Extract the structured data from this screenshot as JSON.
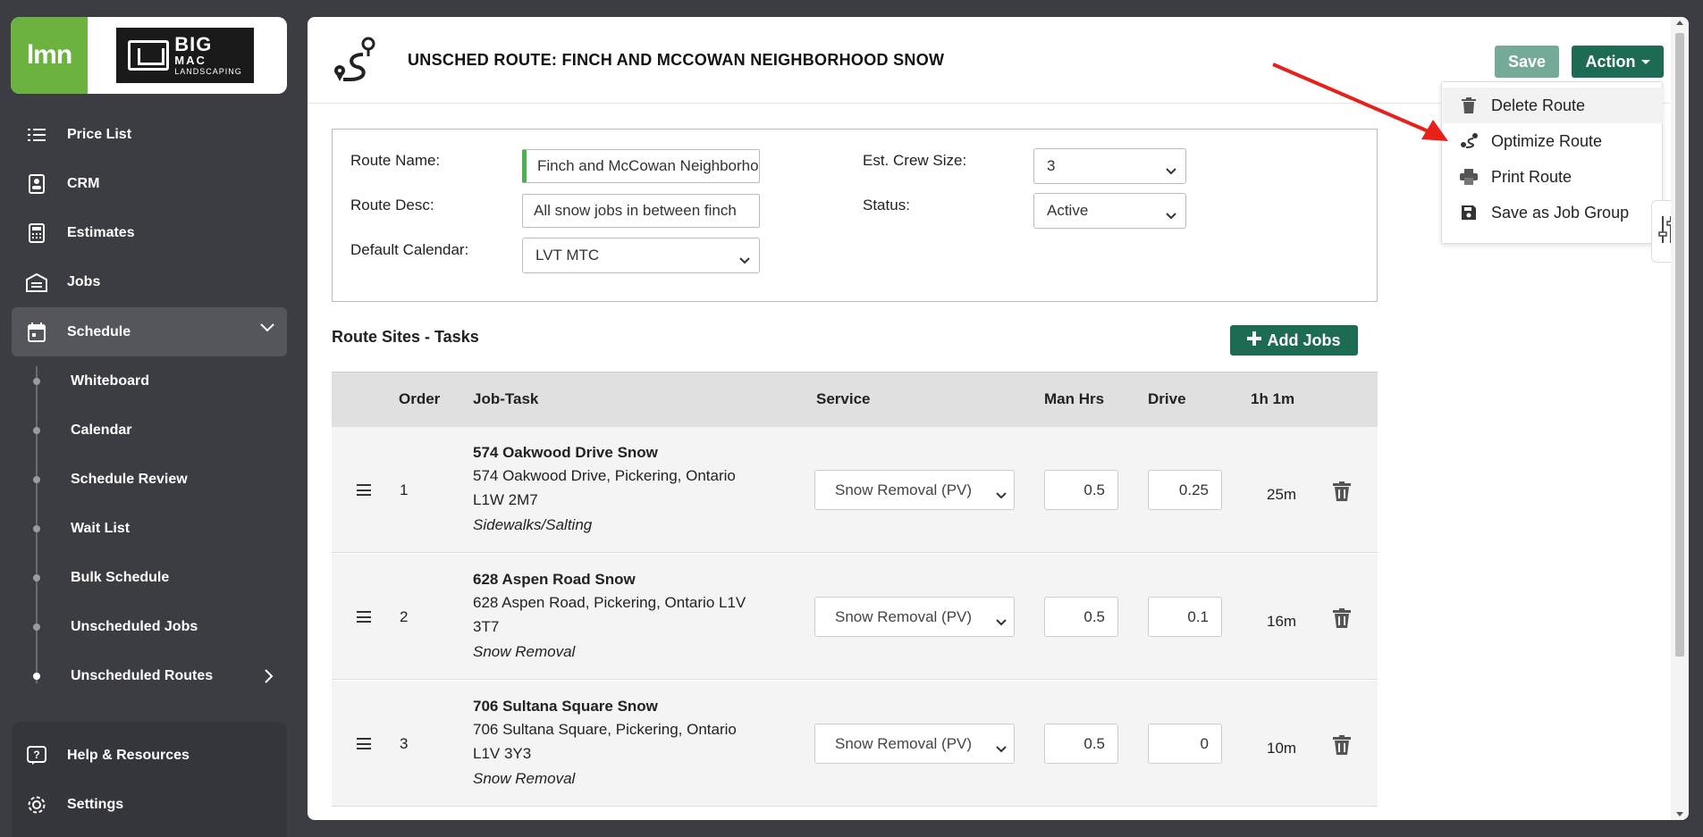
{
  "app": {
    "logo_text": "lmn",
    "company_name_line1": "BIG",
    "company_name_line2": "MAC",
    "company_name_line3": "LANDSCAPING"
  },
  "sidebar": {
    "items": [
      {
        "label": "Price List",
        "icon": "list-icon"
      },
      {
        "label": "CRM",
        "icon": "contact-icon"
      },
      {
        "label": "Estimates",
        "icon": "calculator-icon"
      },
      {
        "label": "Jobs",
        "icon": "building-icon"
      },
      {
        "label": "Schedule",
        "icon": "calendar-icon"
      }
    ],
    "subitems": [
      {
        "label": "Whiteboard"
      },
      {
        "label": "Calendar"
      },
      {
        "label": "Schedule Review"
      },
      {
        "label": "Wait List"
      },
      {
        "label": "Bulk Schedule"
      },
      {
        "label": "Unscheduled Jobs"
      },
      {
        "label": "Unscheduled Routes"
      }
    ],
    "bottom": [
      {
        "label": "Help & Resources",
        "icon": "help-icon"
      },
      {
        "label": "Settings",
        "icon": "gear-icon"
      }
    ]
  },
  "header": {
    "title": "UNSCHED ROUTE: FINCH AND MCCOWAN NEIGHBORHOOD SNOW",
    "save_label": "Save",
    "action_label": "Action"
  },
  "action_menu": {
    "items": [
      {
        "label": "Delete Route",
        "icon": "trash-icon"
      },
      {
        "label": "Optimize Route",
        "icon": "route-icon"
      },
      {
        "label": "Print Route",
        "icon": "printer-icon"
      },
      {
        "label": "Save as Job Group",
        "icon": "floppy-icon"
      }
    ]
  },
  "form": {
    "route_name_label": "Route Name:",
    "route_name_value": "Finch and McCowan Neighborhood Snow",
    "route_desc_label": "Route Desc:",
    "route_desc_value": "All snow jobs in between finch",
    "default_calendar_label": "Default Calendar:",
    "default_calendar_value": "LVT MTC",
    "crew_size_label": "Est. Crew Size:",
    "crew_size_value": "3",
    "status_label": "Status:",
    "status_value": "Active"
  },
  "route_sites": {
    "title": "Route Sites - Tasks",
    "add_jobs_label": "Add Jobs",
    "columns": {
      "order": "Order",
      "job_task": "Job-Task",
      "service": "Service",
      "man_hrs": "Man Hrs",
      "drive": "Drive",
      "total": "1h 1m"
    },
    "rows": [
      {
        "order": "1",
        "name": "574 Oakwood Drive Snow",
        "addr1": "574 Oakwood Drive, Pickering, Ontario",
        "addr2": "L1W 2M7",
        "type": "Sidewalks/Salting",
        "service": "Snow Removal (PV)",
        "man_hrs": "0.5",
        "drive": "0.25",
        "time": "25m"
      },
      {
        "order": "2",
        "name": "628 Aspen Road Snow",
        "addr1": "628 Aspen Road, Pickering, Ontario L1V",
        "addr2": "3T7",
        "type": "Snow Removal",
        "service": "Snow Removal (PV)",
        "man_hrs": "0.5",
        "drive": "0.1",
        "time": "16m"
      },
      {
        "order": "3",
        "name": "706 Sultana Square Snow",
        "addr1": "706 Sultana Square, Pickering, Ontario",
        "addr2": "L1V 3Y3",
        "type": "Snow Removal",
        "service": "Snow Removal (PV)",
        "man_hrs": "0.5",
        "drive": "0",
        "time": "10m"
      }
    ]
  },
  "colors": {
    "accent": "#1e6b55",
    "save_disabled": "#76aa98",
    "lmn_green": "#6bb33e",
    "sidebar_bg": "#3c3d42",
    "arrow_red": "#e8201a"
  }
}
